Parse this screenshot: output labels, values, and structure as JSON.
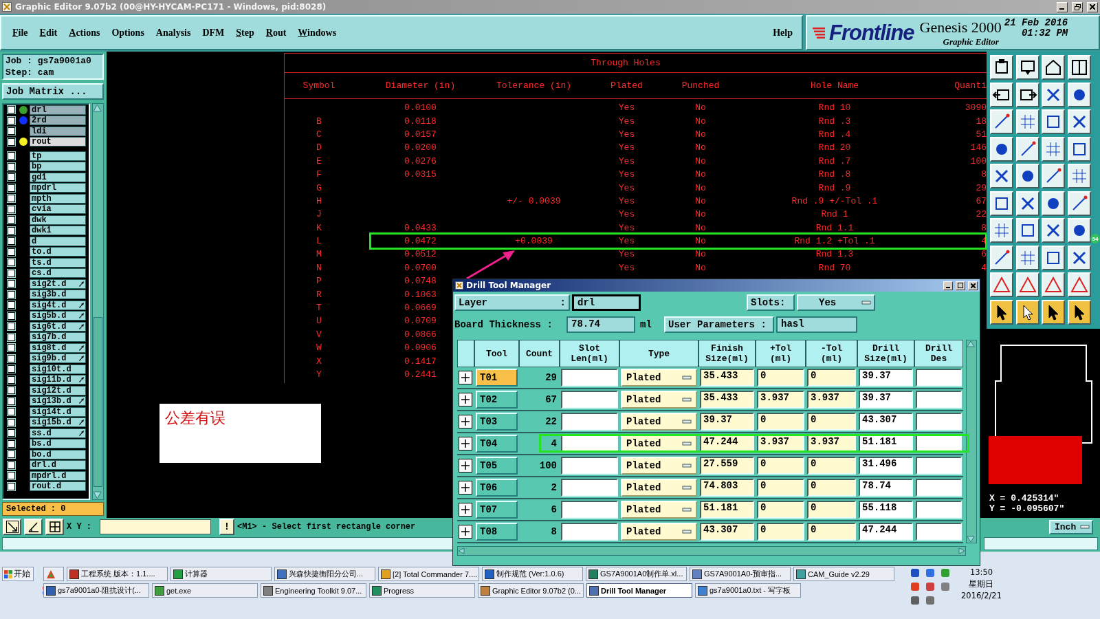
{
  "window": {
    "title": "Graphic Editor 9.07b2 (00@HY-HYCAM-PC171 - Windows, pid:8028)"
  },
  "menu": [
    {
      "label": "File",
      "mnemonic": true
    },
    {
      "label": "Edit",
      "mnemonic": true
    },
    {
      "label": "Actions",
      "mnemonic": true
    },
    {
      "label": "Options",
      "mnemonic": false
    },
    {
      "label": "Analysis",
      "mnemonic": false
    },
    {
      "label": "DFM",
      "mnemonic": false
    },
    {
      "label": "Step",
      "mnemonic": true
    },
    {
      "label": "Rout",
      "mnemonic": true
    },
    {
      "label": "Windows",
      "mnemonic": true
    }
  ],
  "help": "Help",
  "brand": {
    "logo": "Frontline",
    "product": "Genesis 2000",
    "subtitle": "Graphic Editor",
    "date": "21 Feb 2016",
    "time": "01:32 PM"
  },
  "job": {
    "job": "Job : gs7a9001a0",
    "step": "Step: cam",
    "matrix_button": "Job Matrix ..."
  },
  "layers": {
    "board": [
      {
        "name": "drl",
        "color": "#3ca030",
        "checked": false,
        "selected": false
      },
      {
        "name": "2rd",
        "color": "#1030ff",
        "checked": false,
        "selected": false
      },
      {
        "name": "ldi",
        "checked": false,
        "selected": false
      },
      {
        "name": "rout",
        "color": "#f4f020",
        "checked": false,
        "selected": true
      }
    ],
    "misc": [
      {
        "name": "tp",
        "checked": false,
        "marked": false
      },
      {
        "name": "bp",
        "checked": false,
        "marked": false
      },
      {
        "name": "gd1",
        "checked": false,
        "marked": false
      },
      {
        "name": "mpdrl",
        "checked": false,
        "marked": false
      },
      {
        "name": "mpth",
        "checked": false,
        "marked": false
      },
      {
        "name": "cvia",
        "checked": false,
        "marked": false
      },
      {
        "name": "dwk",
        "checked": false,
        "marked": false
      },
      {
        "name": "dwk1",
        "checked": false,
        "marked": false
      },
      {
        "name": "d",
        "checked": false,
        "marked": false
      },
      {
        "name": "to.d",
        "checked": false,
        "marked": false
      },
      {
        "name": "ts.d",
        "checked": false,
        "marked": false
      },
      {
        "name": "cs.d",
        "checked": false,
        "marked": false
      },
      {
        "name": "sig2t.d",
        "checked": false,
        "marked": true
      },
      {
        "name": "sig3b.d",
        "checked": false,
        "marked": false
      },
      {
        "name": "sig4t.d",
        "checked": false,
        "marked": true
      },
      {
        "name": "sig5b.d",
        "checked": false,
        "marked": true
      },
      {
        "name": "sig6t.d",
        "checked": false,
        "marked": true
      },
      {
        "name": "sig7b.d",
        "checked": false,
        "marked": false
      },
      {
        "name": "sig8t.d",
        "checked": false,
        "marked": true
      },
      {
        "name": "sig9b.d",
        "checked": false,
        "marked": true
      },
      {
        "name": "sig10t.d",
        "checked": false,
        "marked": false
      },
      {
        "name": "sig11b.d",
        "checked": false,
        "marked": true
      },
      {
        "name": "sig12t.d",
        "checked": false,
        "marked": false
      },
      {
        "name": "sig13b.d",
        "checked": false,
        "marked": true
      },
      {
        "name": "sig14t.d",
        "checked": false,
        "marked": false
      },
      {
        "name": "sig15b.d",
        "checked": false,
        "marked": true
      },
      {
        "name": "ss.d",
        "checked": false,
        "marked": true
      },
      {
        "name": "bs.d",
        "checked": false,
        "marked": false
      },
      {
        "name": "bo.d",
        "checked": false,
        "marked": false
      },
      {
        "name": "drl.d",
        "checked": false,
        "marked": false
      },
      {
        "name": "mpdrl.d",
        "checked": false,
        "marked": false
      },
      {
        "name": "rout.d",
        "checked": false,
        "marked": false
      }
    ]
  },
  "selected_count": "Selected : 0",
  "holes": {
    "title": "Through Holes",
    "columns": [
      "Symbol",
      "Diameter (in)",
      "Tolerance (in)",
      "Plated",
      "Punched",
      "Hole Name",
      "Quanti"
    ],
    "rows": [
      {
        "diameter": "0.0100",
        "plated": "Yes",
        "punched": "No",
        "hole_name": "Rnd 10",
        "quantity": "3090",
        "highlighted": false
      },
      {
        "symbol": "B",
        "diameter": "0.0118",
        "plated": "Yes",
        "punched": "No",
        "hole_name": "Rnd .3",
        "quantity": "18",
        "highlighted": false
      },
      {
        "symbol": "C",
        "diameter": "0.0157",
        "plated": "Yes",
        "punched": "No",
        "hole_name": "Rnd .4",
        "quantity": "51",
        "highlighted": false
      },
      {
        "symbol": "D",
        "diameter": "0.0200",
        "plated": "Yes",
        "punched": "No",
        "hole_name": "Rnd 20",
        "quantity": "146",
        "highlighted": false
      },
      {
        "symbol": "E",
        "diameter": "0.0276",
        "plated": "Yes",
        "punched": "No",
        "hole_name": "Rnd .7",
        "quantity": "100",
        "highlighted": false
      },
      {
        "symbol": "F",
        "diameter": "0.0315",
        "plated": "Yes",
        "punched": "No",
        "hole_name": "Rnd .8",
        "quantity": "8",
        "highlighted": false
      },
      {
        "symbol": "G",
        "plated": "Yes",
        "punched": "No",
        "hole_name": "Rnd .9",
        "quantity": "29",
        "highlighted": false
      },
      {
        "symbol": "H",
        "tolerance": "+/- 0.0039",
        "plated": "Yes",
        "punched": "No",
        "hole_name": "Rnd .9 +/-Tol .1",
        "quantity": "67",
        "highlighted": false
      },
      {
        "symbol": "J",
        "plated": "Yes",
        "punched": "No",
        "hole_name": "Rnd 1",
        "quantity": "22",
        "highlighted": false
      },
      {
        "symbol": "K",
        "diameter": "0.0433",
        "plated": "Yes",
        "punched": "No",
        "hole_name": "Rnd 1.1",
        "quantity": "8",
        "highlighted": false
      },
      {
        "symbol": "L",
        "diameter": "0.0472",
        "tolerance": "+0.0039",
        "plated": "Yes",
        "punched": "No",
        "hole_name": "Rnd 1.2 +Tol .1",
        "quantity": "4",
        "highlighted": true
      },
      {
        "symbol": "M",
        "diameter": "0.0512",
        "plated": "Yes",
        "punched": "No",
        "hole_name": "Rnd 1.3",
        "quantity": "6",
        "highlighted": false
      },
      {
        "symbol": "N",
        "diameter": "0.0700",
        "plated": "Yes",
        "punched": "No",
        "hole_name": "Rnd 70",
        "quantity": "4",
        "highlighted": false
      },
      {
        "symbol": "P",
        "diameter": "0.0748",
        "highlighted": false
      },
      {
        "symbol": "R",
        "diameter": "0.1063",
        "highlighted": false
      },
      {
        "symbol": "T",
        "diameter": "0.0669",
        "highlighted": false
      },
      {
        "symbol": "U",
        "diameter": "0.0709",
        "highlighted": false
      },
      {
        "symbol": "V",
        "diameter": "0.0866",
        "highlighted": false
      },
      {
        "symbol": "W",
        "diameter": "0.0906",
        "highlighted": false
      },
      {
        "symbol": "X",
        "diameter": "0.1417",
        "highlighted": false
      },
      {
        "symbol": "Y",
        "diameter": "0.2441",
        "highlighted": false
      }
    ]
  },
  "note": "公差有误",
  "dialog": {
    "title": "Drill Tool Manager",
    "layer": {
      "label": "Layer",
      "separator": ":",
      "value": "drl"
    },
    "slots": {
      "label": "Slots:",
      "value": "Yes"
    },
    "thickness": {
      "label": "Board Thickness :",
      "value": "78.74",
      "unit": "ml"
    },
    "user_params": {
      "label": "User Parameters :",
      "value": "hasl"
    },
    "columns": [
      "Tool",
      "Count",
      "Slot Len(ml)",
      "Type",
      "Finish Size(ml)",
      "+Tol (ml)",
      "-Tol (ml)",
      "Drill Size(ml)",
      "Drill Des"
    ],
    "rows": [
      {
        "tool": "T01",
        "count": "29",
        "type": "Plated",
        "finish": "35.433",
        "plus_tol": "0",
        "minus_tol": "0",
        "drill_size": "39.37",
        "selected": true,
        "highlighted": false
      },
      {
        "tool": "T02",
        "count": "67",
        "type": "Plated",
        "finish": "35.433",
        "plus_tol": "3.937",
        "minus_tol": "3.937",
        "drill_size": "39.37",
        "selected": false,
        "highlighted": false
      },
      {
        "tool": "T03",
        "count": "22",
        "type": "Plated",
        "finish": "39.37",
        "plus_tol": "0",
        "minus_tol": "0",
        "drill_size": "43.307",
        "selected": false,
        "highlighted": false
      },
      {
        "tool": "T04",
        "count": "4",
        "type": "Plated",
        "finish": "47.244",
        "plus_tol": "3.937",
        "minus_tol": "3.937",
        "drill_size": "51.181",
        "selected": false,
        "highlighted": true
      },
      {
        "tool": "T05",
        "count": "100",
        "type": "Plated",
        "finish": "27.559",
        "plus_tol": "0",
        "minus_tol": "0",
        "drill_size": "31.496",
        "selected": false,
        "highlighted": false
      },
      {
        "tool": "T06",
        "count": "2",
        "type": "Plated",
        "finish": "74.803",
        "plus_tol": "0",
        "minus_tol": "0",
        "drill_size": "78.74",
        "selected": false,
        "highlighted": false
      },
      {
        "tool": "T07",
        "count": "6",
        "type": "Plated",
        "finish": "51.181",
        "plus_tol": "0",
        "minus_tol": "0",
        "drill_size": "55.118",
        "selected": false,
        "highlighted": false
      },
      {
        "tool": "T08",
        "count": "8",
        "type": "Plated",
        "finish": "43.307",
        "plus_tol": "0",
        "minus_tol": "0",
        "drill_size": "47.244",
        "selected": false,
        "highlighted": false
      }
    ]
  },
  "command": {
    "xy_label": "X Y :",
    "bang": "!",
    "prompt": "<M1> - Select first rectangle corner"
  },
  "coords": {
    "x": "X = 0.425314\"",
    "y": "Y = -0.095607\""
  },
  "units": "Inch",
  "badge": "54",
  "taskbar": {
    "start": "开始",
    "row1": [
      {
        "label": "工程系统  版本：1.1....",
        "selected": false
      },
      {
        "label": "计算器",
        "selected": false
      },
      {
        "label": "兴森快捷衡阳分公司...",
        "selected": false
      },
      {
        "label": "[2] Total Commander 7....",
        "selected": false
      },
      {
        "label": "制作规范 (Ver:1.0.6)",
        "selected": false
      },
      {
        "label": "GS7A9001A0制作单.xl...",
        "selected": false
      },
      {
        "label": "GS7A9001A0-预审指...",
        "selected": false
      },
      {
        "label": "CAM_Guide v2.29",
        "selected": false
      }
    ],
    "row2": [
      {
        "label": "gs7a9001a0-阻抗设计(...",
        "selected": false
      },
      {
        "label": "get.exe",
        "selected": false
      },
      {
        "label": "Engineering Toolkit 9.07...",
        "selected": false
      },
      {
        "label": "Progress",
        "selected": false
      },
      {
        "label": "Graphic Editor 9.07b2 (0...",
        "selected": false
      },
      {
        "label": "Drill Tool Manager",
        "selected": true
      },
      {
        "label": "gs7a9001a0.txt - 写字板",
        "selected": false
      }
    ],
    "clock": {
      "time": "13:50",
      "day": "星期日",
      "date": "2016/2/21"
    }
  }
}
